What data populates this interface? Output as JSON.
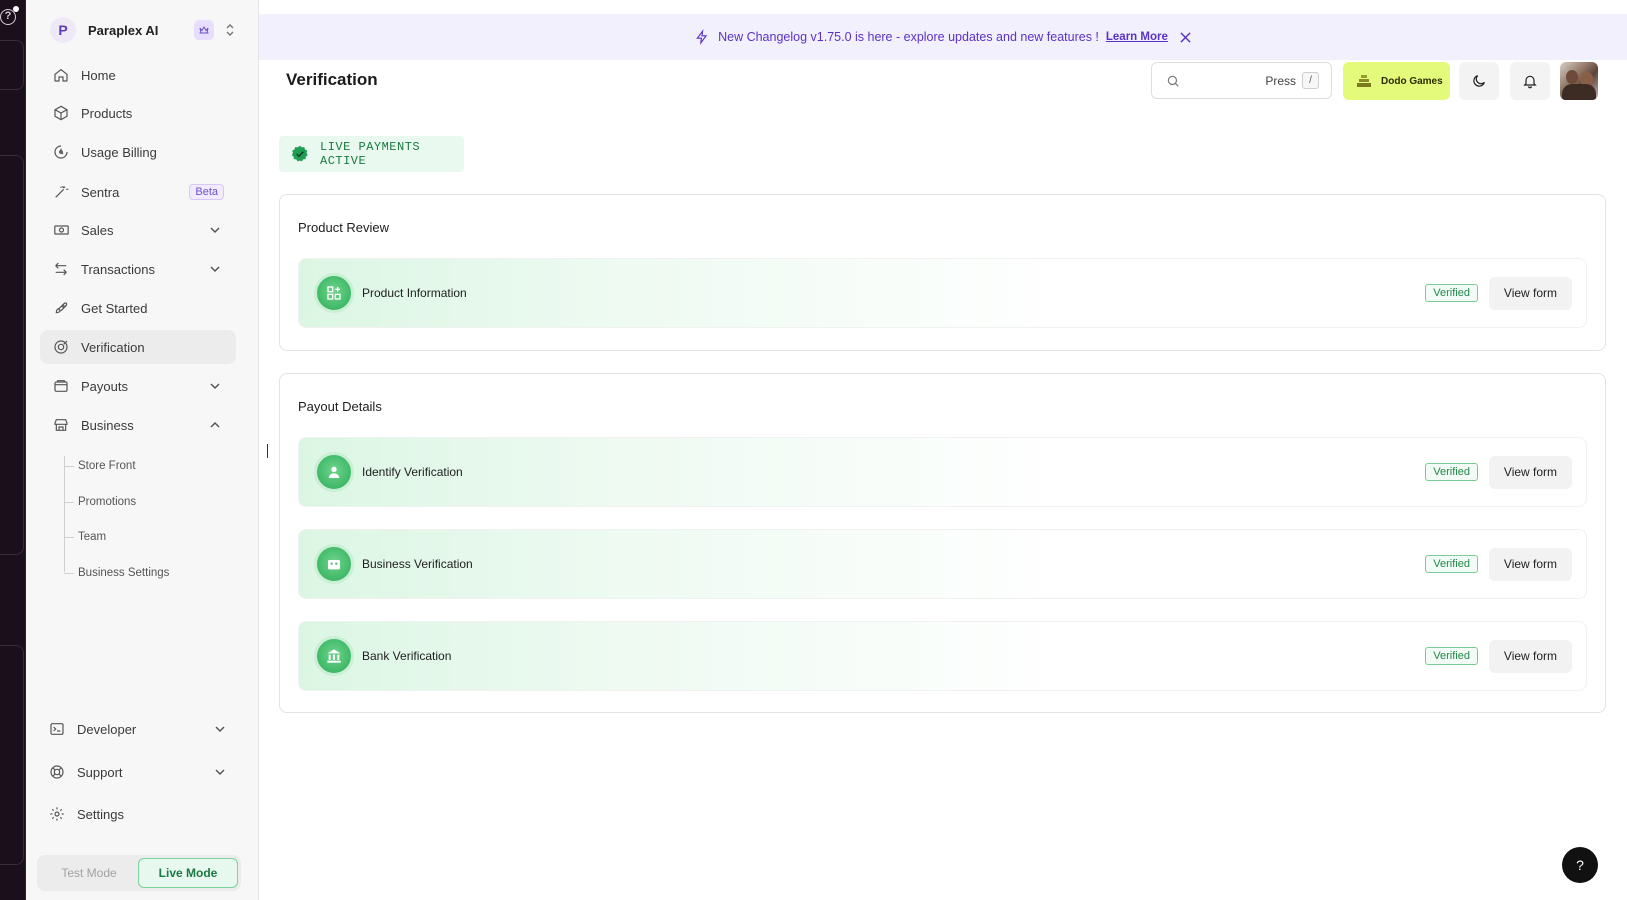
{
  "org": {
    "initial": "P",
    "name": "Paraplex AI"
  },
  "sidebar": {
    "items": [
      {
        "label": "Home",
        "icon": "home-icon"
      },
      {
        "label": "Products",
        "icon": "box-icon"
      },
      {
        "label": "Usage Billing",
        "icon": "usage-billing-icon"
      },
      {
        "label": "Sentra",
        "icon": "magic-wand-icon",
        "badge": "Beta"
      },
      {
        "label": "Sales",
        "icon": "banknote-icon"
      },
      {
        "label": "Transactions",
        "icon": "arrows-swap-icon"
      },
      {
        "label": "Get Started",
        "icon": "rocket-icon"
      },
      {
        "label": "Verification",
        "icon": "badge-check-icon"
      },
      {
        "label": "Payouts",
        "icon": "wallet-icon"
      },
      {
        "label": "Business",
        "icon": "store-icon"
      }
    ],
    "business_subitems": [
      "Store Front",
      "Promotions",
      "Team",
      "Business Settings"
    ],
    "bottom_items": [
      {
        "label": "Developer",
        "icon": "terminal-icon"
      },
      {
        "label": "Support",
        "icon": "lifebuoy-icon"
      },
      {
        "label": "Settings",
        "icon": "gear-icon"
      }
    ],
    "mode": {
      "test": "Test Mode",
      "live": "Live Mode",
      "selected": "Live Mode"
    }
  },
  "banner": {
    "text": "New Changelog v1.75.0 is here - explore updates and new features !",
    "link": "Learn More"
  },
  "header": {
    "title": "Verification",
    "search_hint": "Press",
    "search_key": "/",
    "brand_button": "Dodo Games"
  },
  "status_badge": "LIVE PAYMENTS ACTIVE",
  "sections": [
    {
      "title": "Product Review",
      "rows": [
        {
          "label": "Product Information",
          "status": "Verified",
          "action": "View form",
          "icon": "product-grid-icon"
        }
      ]
    },
    {
      "title": "Payout Details",
      "rows": [
        {
          "label": "Identify Verification",
          "status": "Verified",
          "action": "View form",
          "icon": "user-icon"
        },
        {
          "label": "Business Verification",
          "status": "Verified",
          "action": "View form",
          "icon": "store-icon"
        },
        {
          "label": "Bank Verification",
          "status": "Verified",
          "action": "View form",
          "icon": "bank-icon"
        }
      ]
    }
  ],
  "help_fab": "?",
  "colors": {
    "accent_purple": "#5a32c8",
    "live_green": "#1b7a43",
    "brand_lime": "#e3fa7a",
    "banner_bg": "#f3f0fd"
  }
}
